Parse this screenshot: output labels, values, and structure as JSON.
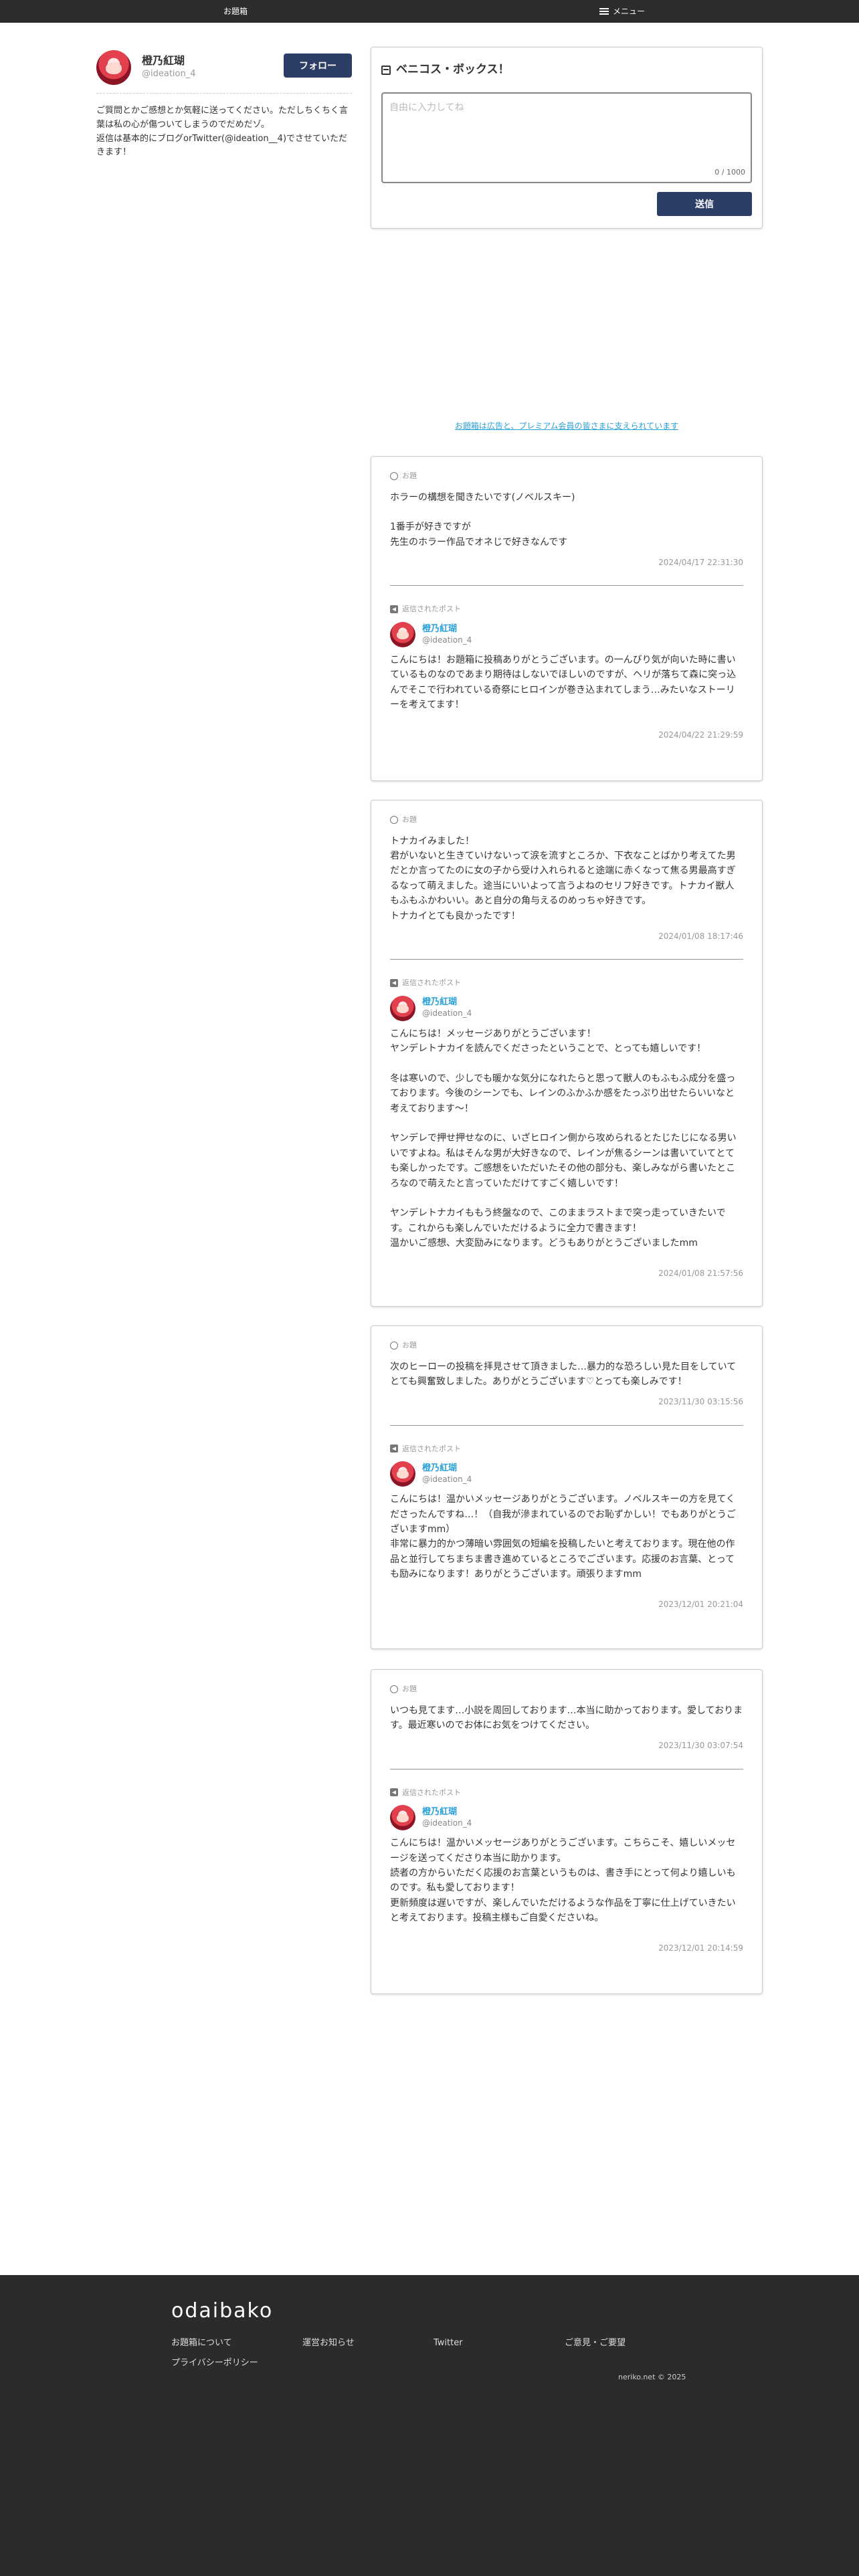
{
  "topbar": {
    "home_label": "お題箱",
    "menu_label": "メニュー"
  },
  "profile": {
    "name": "橙乃紅瑚",
    "handle": "@ideation_4",
    "follow_label": "フォロー",
    "description": "ご質問とかご感想とか気軽に送ってください。ただしちくちく言葉は私の心が傷ついてしまうのでだめだゾ。\n返信は基本的にブログorTwitter(@ideation__4)でさせていただきます！"
  },
  "box": {
    "title": "ベニコス・ボックス！",
    "placeholder": "自由に入力してね",
    "char_count": "0 / 1000",
    "send_label": "送信"
  },
  "ad_notice": "お題箱は広告と、プレミアム会員の皆さまに支えられています",
  "labels": {
    "question": "お題",
    "reply": "返信されたポスト"
  },
  "posts": [
    {
      "question": "ホラーの構想を聞きたいです(ノベルスキー)\n\n1番手が好きですが\n先生のホラー作品でオネじで好きなんです",
      "question_ts": "2024/04/17 22:31:30",
      "reply_name": "橙乃紅瑚",
      "reply_handle": "@ideation_4",
      "reply": "こんにちは！お題箱に投稿ありがとうございます。の一んびり気が向いた時に書いているものなのであまり期待はしないでほしいのですが、ヘリが落ちて森に突っ込んでそこで行われている奇祭にヒロインが巻き込まれてしまう…みたいなストーリーを考えてます！",
      "reply_ts": "2024/04/22 21:29:59"
    },
    {
      "question": "トナカイみました！\n君がいないと生きていけないって涙を流すところか、下衣なことばかり考えてた男だとか言ってたのに女の子から受け入れられると途端に赤くなって焦る男最高すぎるなって萌えました。途当にいいよって言うよねのセリフ好きです。トナカイ獣人もふもふかわいい。あと自分の角与えるのめっちゃ好きです。\nトナカイとても良かったです！",
      "question_ts": "2024/01/08 18:17:46",
      "reply_name": "橙乃紅瑚",
      "reply_handle": "@ideation_4",
      "reply": "こんにちは！メッセージありがとうございます！\nヤンデレトナカイを読んでくださったということで、とっても嬉しいです！\n\n冬は寒いので、少しでも暖かな気分になれたらと思って獣人のもふもふ成分を盛っております。今後のシーンでも、レインのふかふか感をたっぷり出せたらいいなと考えております〜！\n\nヤンデレで押せ押せなのに、いざヒロイン側から攻められるとたじたじになる男いいですよね。私はそんな男が大好きなので、レインが焦るシーンは書いていてとても楽しかったです。ご感想をいただいたその他の部分も、楽しみながら書いたところなので萌えたと言っていただけてすごく嬉しいです！\n\nヤンデレトナカイももう終盤なので、このままラストまで突っ走っていきたいです。これからも楽しんでいただけるように全力で書きます！\n温かいご感想、大変励みになります。どうもありがとうございましたmm",
      "reply_ts": "2024/01/08 21:57:56"
    },
    {
      "question": "次のヒーローの投稿を拝見させて頂きました…暴力的な恐ろしい見た目をしていてとても興奮致しました。ありがとうございます♡とっても楽しみです！",
      "question_ts": "2023/11/30 03:15:56",
      "reply_name": "橙乃紅瑚",
      "reply_handle": "@ideation_4",
      "reply": "こんにちは！温かいメッセージありがとうございます。ノベルスキーの方を見てくださったんですね…！（自我が滲まれているのでお恥ずかしい！でもありがとうございますmm）\n非常に暴力的かつ薄暗い雰囲気の短編を投稿したいと考えております。現在他の作品と並行してちまちま書き進めているところでございます。応援のお言葉、とっても励みになります！ありがとうございます。頑張りますmm",
      "reply_ts": "2023/12/01 20:21:04"
    },
    {
      "question": "いつも見てます…小説を周回しております…本当に助かっております。愛しております。最近寒いのでお体にお気をつけてください。",
      "question_ts": "2023/11/30 03:07:54",
      "reply_name": "橙乃紅瑚",
      "reply_handle": "@ideation_4",
      "reply": "こんにちは！温かいメッセージありがとうございます。こちらこそ、嬉しいメッセージを送ってくださり本当に助かります。\n読者の方からいただく応援のお言葉というものは、書き手にとって何より嬉しいものです。私も愛しております！\n更新頻度は遅いですが、楽しんでいただけるような作品を丁寧に仕上げていきたいと考えております。投稿主様もご自愛くださいね。",
      "reply_ts": "2023/12/01 20:14:59"
    }
  ],
  "footer": {
    "logo": "odaibako",
    "links": [
      "お題箱について",
      "運営お知らせ",
      "Twitter",
      "ご意見・ご要望",
      "プライバシーポリシー"
    ],
    "copyright": "neriko.net © 2025"
  }
}
